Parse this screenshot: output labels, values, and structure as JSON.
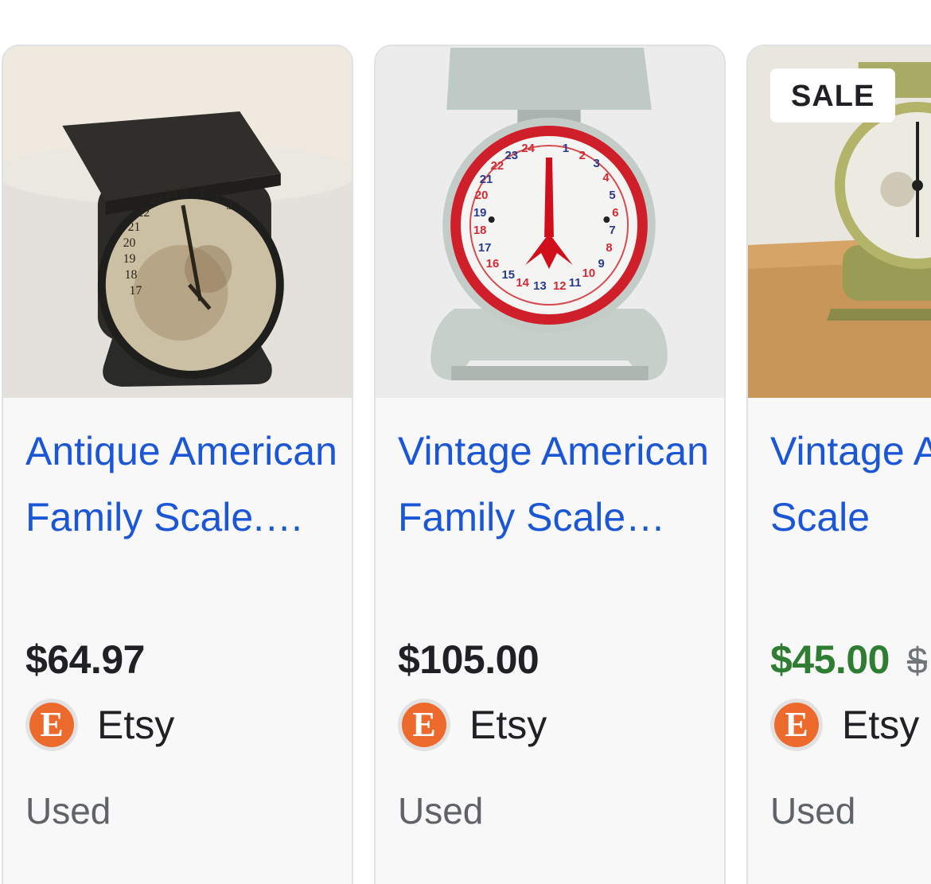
{
  "results": [
    {
      "title": "Antique American Family Scale.…",
      "price": "$64.97",
      "merchant": "Etsy",
      "merchant_logo_letter": "E",
      "condition": "Used",
      "image": "rusty-antique-kitchen-scale"
    },
    {
      "title": "Vintage American Family Scale…",
      "price": "$105.00",
      "merchant": "Etsy",
      "merchant_logo_letter": "E",
      "condition": "Used",
      "image": "grey-vintage-kitchen-scale-red-dial"
    },
    {
      "title": "Vintage American Family Scale",
      "badge": "SALE",
      "sale_price": "$45.00",
      "original_price": "$",
      "merchant": "Etsy",
      "merchant_logo_letter": "E",
      "condition": "Used",
      "image": "green-vintage-kitchen-scale"
    }
  ],
  "colors": {
    "link": "#1a56d6",
    "sale_price": "#2e7d32",
    "etsy_orange": "#ec6a2c"
  }
}
